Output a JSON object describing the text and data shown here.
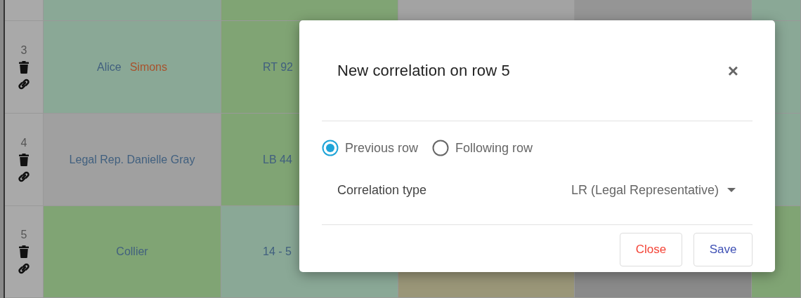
{
  "table": {
    "rows": [
      {
        "cells": [
          {
            "color": "#8aa896"
          },
          {
            "color": "#80a474"
          },
          {
            "color": "#a3a3a3"
          },
          {
            "color": "#959595"
          },
          {
            "color": "#8aa896"
          }
        ]
      },
      {
        "number": "3",
        "cells": [
          {
            "color": "#8aa896",
            "parts": [
              {
                "text": "Alice"
              },
              {
                "text": "Simons",
                "color": "#a8522c"
              }
            ]
          },
          {
            "color": "#80a474",
            "parts": [
              {
                "text": "RT 92"
              }
            ]
          },
          null,
          null,
          {
            "color": "#8aa896"
          }
        ]
      },
      {
        "number": "4",
        "cells": [
          {
            "color": "#a0a0a0",
            "parts": [
              {
                "text": "Legal Rep. Danielle Gray"
              }
            ]
          },
          {
            "color": "#80a474",
            "parts": [
              {
                "text": "LB 44"
              }
            ]
          },
          null,
          null,
          {
            "color": "#8aa896"
          }
        ]
      },
      {
        "number": "5",
        "cells": [
          {
            "color": "#80a474",
            "parts": [
              {
                "text": "Collier"
              }
            ]
          },
          {
            "color": "#8aa896",
            "parts": [
              {
                "text": "14 - 5"
              }
            ]
          },
          {
            "color": "#9a9678"
          },
          {
            "color": "#8a8a8a"
          },
          {
            "color": "#80a474"
          }
        ]
      }
    ]
  },
  "dialog": {
    "title": "New correlation on row 5",
    "close": "×",
    "options": [
      {
        "label": "Previous row",
        "selected": true
      },
      {
        "label": "Following row",
        "selected": false
      }
    ],
    "field": {
      "label": "Correlation type",
      "value": "LR (Legal Representative)"
    },
    "buttons": [
      {
        "label": "Close",
        "kind": "cancel"
      },
      {
        "label": "Save",
        "kind": "primary"
      }
    ]
  }
}
